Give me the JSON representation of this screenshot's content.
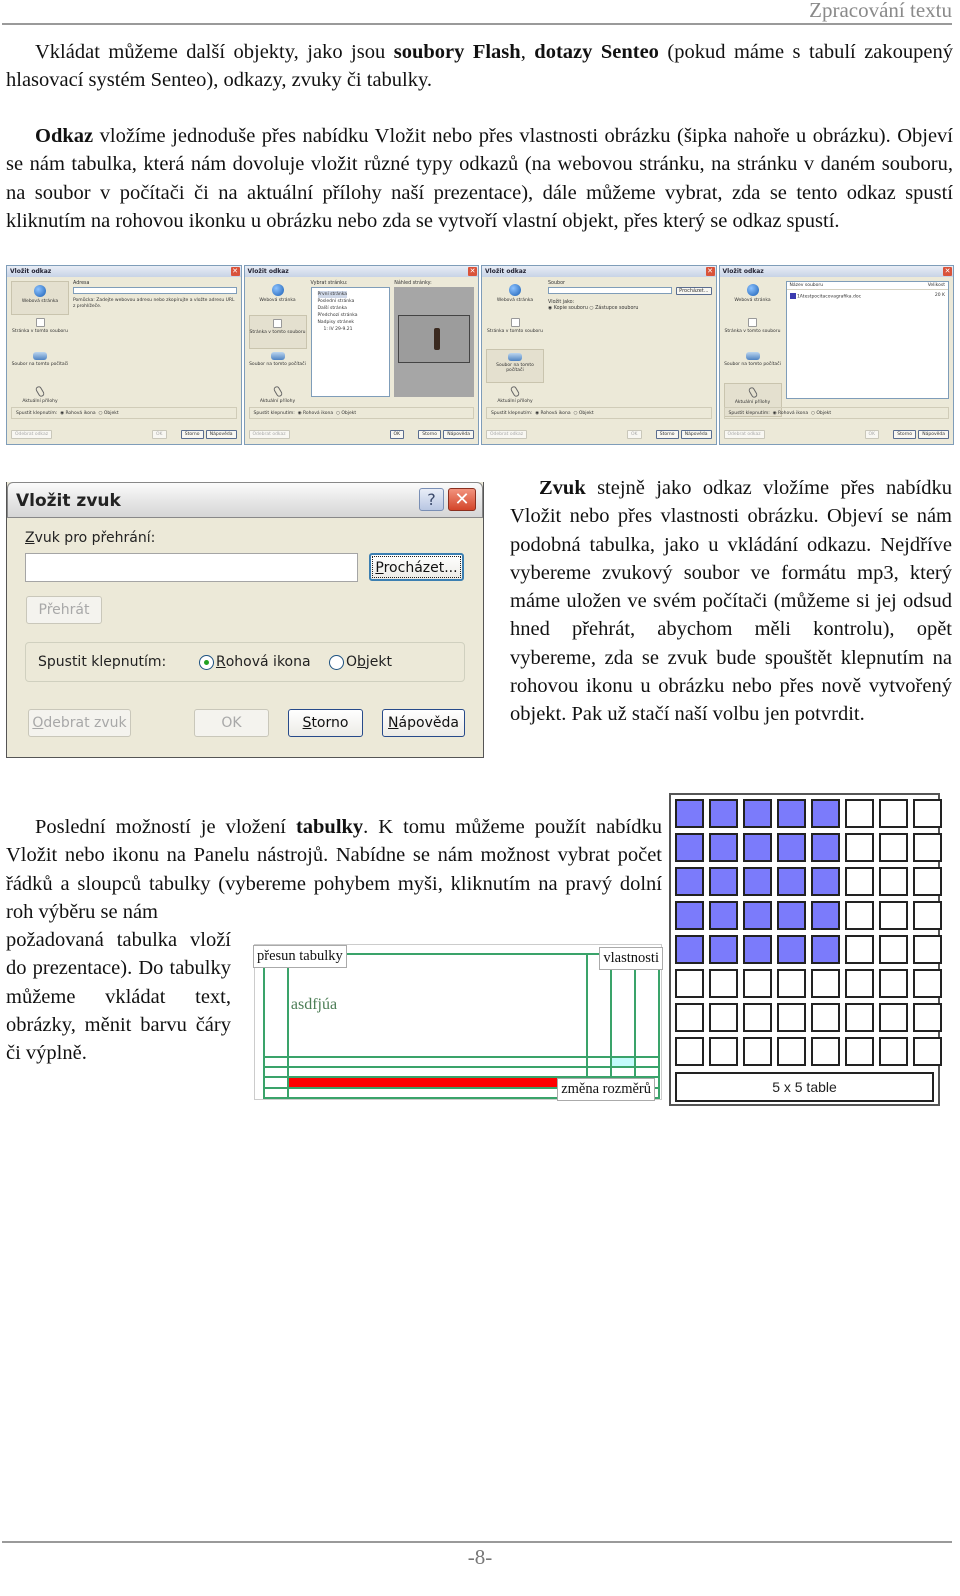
{
  "header": {
    "title": "Zpracování textu"
  },
  "paragraphs": {
    "p1": {
      "t1": "Vkládat můžeme další objekty, jako jsou ",
      "b1": "soubory Flash",
      "t2": ", ",
      "b2": "dotazy Senteo",
      "t3": " (pokud máme s tabulí zakoupený hlasovací systém Senteo), odkazy, zvuky či tabulky."
    },
    "p2": {
      "b1": "Odkaz",
      "t1": " vložíme jednoduše přes nabídku Vložit nebo přes vlastnosti obrázku (šipka nahoře u obrázku). Objeví se nám tabulka, která nám dovoluje vložit různé typy odkazů (na webovou stránku, na stránku v daném souboru, na soubor v počítači či na aktuální přílohy naší prezentace), dále můžeme vybrat, zda se tento odkaz spustí kliknutím na rohovou ikonku u obrázku nebo zda se vytvoří vlastní objekt, přes který se odkaz spustí."
    },
    "p3": {
      "b1": "Zvuk",
      "t1": " stejně jako odkaz vložíme přes nabídku Vložit nebo přes vlastnosti obrázku. Objeví se nám podobná tabulka, jako u vkládání odkazu. Nejdříve vybereme zvukový soubor ve formátu mp3, který máme uložen ve svém počítači (můžeme si jej odsud hned přehrát, abychom měli kontrolu), opět vybereme, zda se zvuk bude spouštět klepnutím na rohovou ikonu u obrázku nebo přes nově vytvořený objekt. Pak už stačí naší volbu jen potvrdit."
    },
    "p4": {
      "t1": "Poslední možností je vložení ",
      "b1": "tabulky",
      "t2": ". K tomu můžeme použít nabídku Vložit nebo ikonu na Panelu nástrojů. Nabídne se nám možnost vybrat počet řádků a sloupců tabulky (vybereme pohybem myši, kliknutím na pravý dolní roh výběru se nám"
    },
    "p5": {
      "t1": "požadovaná tabulka vloží do prezentace). Do tabulky můžeme vkládat text, obrázky, měnit barvu čáry či výplně."
    }
  },
  "link_dialogs": {
    "title": "Vložit odkaz",
    "sidebar": [
      "Webová stránka",
      "Stránka v tomto souboru",
      "Soubor na tomto počítači",
      "Aktuální přílohy"
    ],
    "d1": {
      "address_label": "Adresa",
      "hint": "Pomůcka: Zadejte webovou adresu nebo zkopírujte a vložte adresu URL z prohlížeče."
    },
    "d2": {
      "select_label": "Vybrat stránku:",
      "preview_label": "Náhled stránky:",
      "pages": [
        "První stránka",
        "Poslední stránka",
        "Další stránka",
        "Předchozí stránka",
        "Nadpisy stránek",
        "1: IV 29-9.21"
      ]
    },
    "d3": {
      "file_label": "Soubor",
      "browse": "Procházet...",
      "insert_as": "Vložit jako:",
      "opt_copy": "Kopie souboru",
      "opt_shortcut": "Zástupce souboru"
    },
    "d4": {
      "col_name": "Název souboru",
      "col_size": "Velikost",
      "file_name": "1Atestpocitacovagrafika.doc",
      "file_size": "20 K"
    },
    "launch_label": "Spustit klepnutím:",
    "opt_corner": "Rohová ikona",
    "opt_object": "Objekt",
    "remove": "Odebrat odkaz",
    "ok": "OK",
    "cancel": "Storno",
    "help": "Nápověda"
  },
  "sound_dialog": {
    "title": "Vložit zvuk",
    "help_icon": "?",
    "close_icon": "✕",
    "field_label_u": "Z",
    "field_label_rest": "vuk pro přehrání:",
    "field_value": "",
    "browse_u": "P",
    "browse_rest": "rocházet...",
    "play": "Přehrát",
    "launch_label": "Spustit klepnutím:",
    "opt_corner_u": "R",
    "opt_corner_rest": "ohová ikona",
    "opt_object_a": "O",
    "opt_object_u": "b",
    "opt_object_rest": "jekt",
    "selected": "Rohová ikona",
    "remove_u": "O",
    "remove_rest": "debrat zvuk",
    "ok": "OK",
    "cancel_u": "S",
    "cancel_rest": "torno",
    "help_u": "N",
    "help_rest": "ápověda"
  },
  "table_example": {
    "cell_text": "asdfjúa",
    "tag_move": "přesun tabulky",
    "tag_props": "vlastnosti",
    "tag_resize": "změna rozměrů",
    "colors": {
      "grid": "#3aa36a",
      "red_cell": "#ff0000",
      "cyan_cell": "#c3fbfb"
    }
  },
  "table_picker": {
    "grid_rows": 8,
    "grid_cols": 8,
    "selected_rows": 5,
    "selected_cols": 5,
    "label": "5 x 5 table",
    "highlight_color": "#7b7bfb"
  },
  "footer": {
    "page_number": "-8-"
  }
}
